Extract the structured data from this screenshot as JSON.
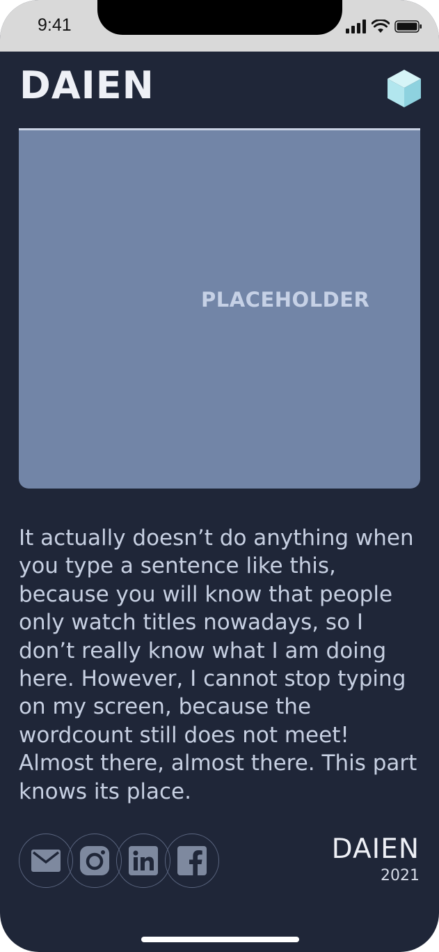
{
  "status_bar": {
    "time": "9:41",
    "icons": [
      "signal-icon",
      "wifi-icon",
      "battery-icon"
    ]
  },
  "header": {
    "brand": "DAIEN",
    "logo_icon": "cube-icon"
  },
  "hero": {
    "placeholder_label": "PLACEHOLDER",
    "background_color": "#7285a7"
  },
  "content": {
    "body": "It actually doesn’t do anything when you type a sentence like this, because you will know that people only watch titles nowadays, so I don’t really know what I am doing here. However, I cannot stop typing on my screen, because the wordcount still does not meet! Almost there, almost there. This part knows its place."
  },
  "social": {
    "items": [
      {
        "icon": "mail-icon"
      },
      {
        "icon": "instagram-icon"
      },
      {
        "icon": "linkedin-icon"
      },
      {
        "icon": "facebook-icon"
      }
    ]
  },
  "footer": {
    "name": "DAIEN",
    "year": "2021"
  },
  "colors": {
    "background": "#1f2638",
    "accent_cube": "#a9e4ee",
    "text": "#c7d0e2"
  }
}
